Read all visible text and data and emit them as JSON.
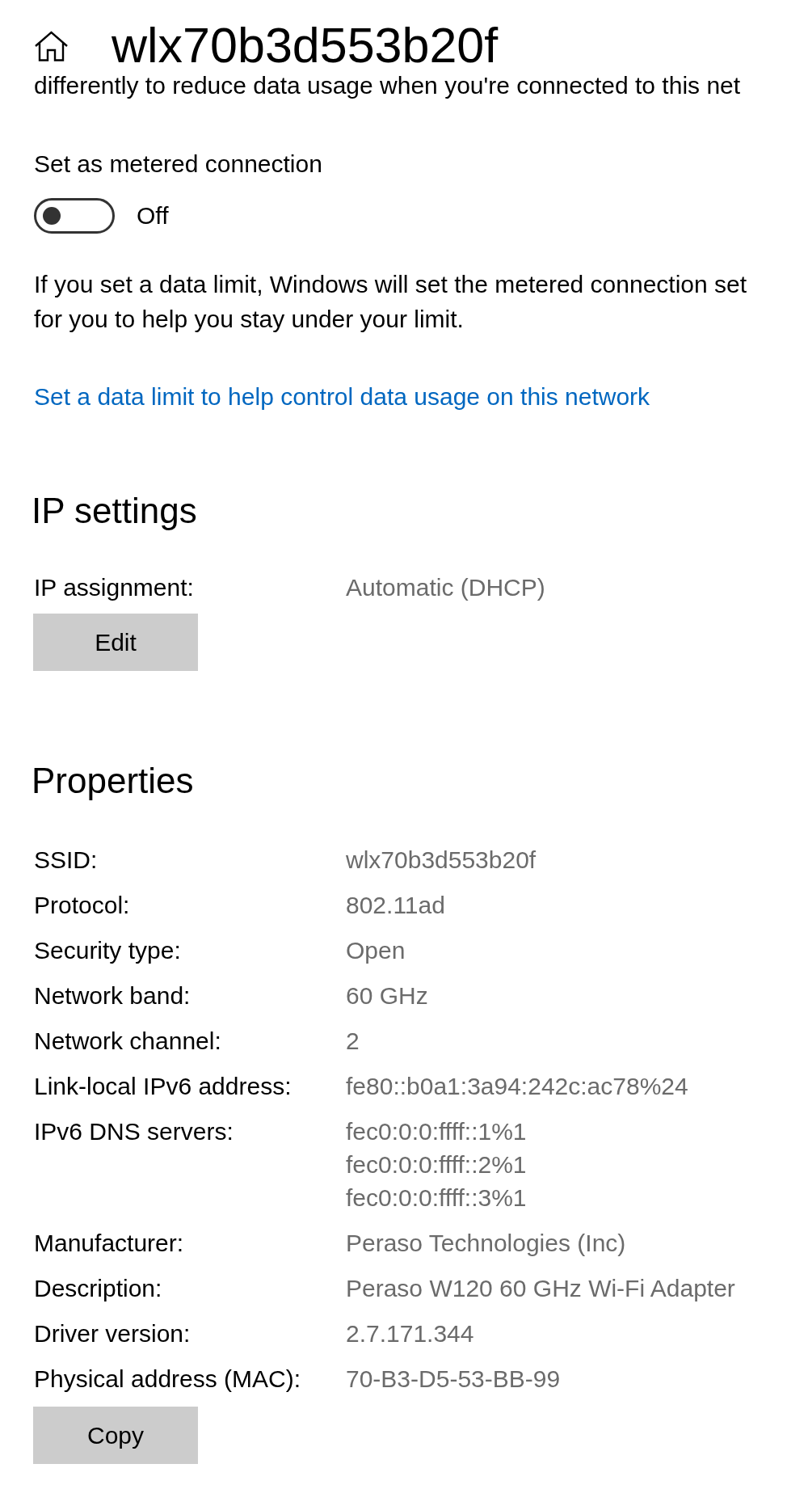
{
  "header": {
    "title": "wlx70b3d553b20f"
  },
  "metered": {
    "intro_text": "differently to reduce data usage when you're connected to this net",
    "label": "Set as metered connection",
    "toggle": {
      "on": false,
      "state_label": "Off"
    },
    "description": "If you set a data limit, Windows will set the metered connection set\nfor you to help you stay under your limit.",
    "link": "Set a data limit to help control data usage on this network"
  },
  "ip_settings": {
    "heading": "IP settings",
    "rows": [
      {
        "label": "IP assignment:",
        "values": [
          "Automatic (DHCP)"
        ]
      }
    ],
    "button": "Edit"
  },
  "properties": {
    "heading": "Properties",
    "rows": [
      {
        "label": "SSID:",
        "values": [
          "wlx70b3d553b20f"
        ]
      },
      {
        "label": "Protocol:",
        "values": [
          "802.11ad"
        ]
      },
      {
        "label": "Security type:",
        "values": [
          "Open"
        ]
      },
      {
        "label": "Network band:",
        "values": [
          "60 GHz"
        ]
      },
      {
        "label": "Network channel:",
        "values": [
          "2"
        ]
      },
      {
        "label": "Link-local IPv6 address:",
        "values": [
          "fe80::b0a1:3a94:242c:ac78%24"
        ]
      },
      {
        "label": "IPv6 DNS servers:",
        "values": [
          "fec0:0:0:ffff::1%1",
          "fec0:0:0:ffff::2%1",
          "fec0:0:0:ffff::3%1"
        ]
      },
      {
        "label": "Manufacturer:",
        "values": [
          "Peraso Technologies (Inc)"
        ]
      },
      {
        "label": "Description:",
        "values": [
          "Peraso W120 60 GHz Wi-Fi Adapter"
        ]
      },
      {
        "label": "Driver version:",
        "values": [
          "2.7.171.344"
        ]
      },
      {
        "label": "Physical address (MAC):",
        "values": [
          "70-B3-D5-53-BB-99"
        ]
      }
    ],
    "button": "Copy"
  }
}
